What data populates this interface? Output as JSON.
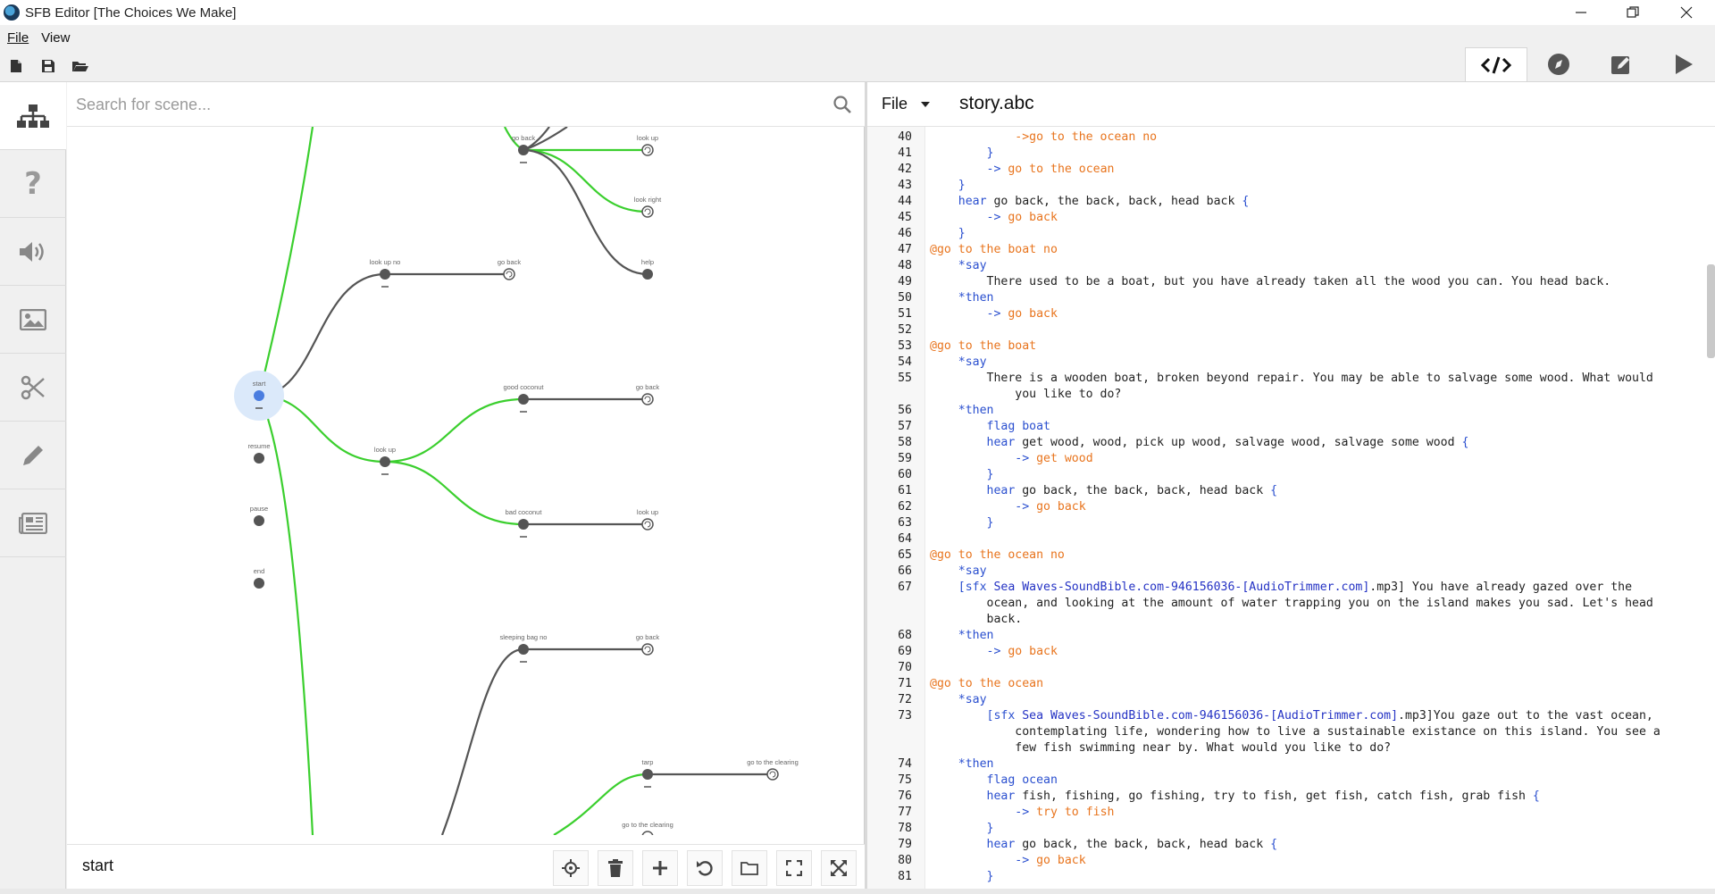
{
  "window": {
    "title": "SFB Editor [The Choices We Make]"
  },
  "menu": {
    "file": "File",
    "view": "View"
  },
  "toolbar": {
    "new_icon": "new-file-icon",
    "save_icon": "save-icon",
    "open_icon": "open-folder-icon"
  },
  "mode_tabs": [
    {
      "name": "code",
      "icon": "code-icon",
      "active": true
    },
    {
      "name": "navigate",
      "icon": "compass-icon",
      "active": false
    },
    {
      "name": "edit",
      "icon": "pencil-square-icon",
      "active": false
    },
    {
      "name": "play",
      "icon": "play-icon",
      "active": false
    }
  ],
  "sidebar": [
    {
      "icon": "hierarchy-icon",
      "active": true
    },
    {
      "icon": "question-icon",
      "active": false
    },
    {
      "icon": "speaker-icon",
      "active": false
    },
    {
      "icon": "image-icon",
      "active": false
    },
    {
      "icon": "scissors-icon",
      "active": false
    },
    {
      "icon": "pencil-icon",
      "active": false
    },
    {
      "icon": "newspaper-icon",
      "active": false
    }
  ],
  "graph": {
    "search_placeholder": "Search for scene...",
    "selected_scene": "start",
    "nodes": [
      {
        "id": "go-back-top",
        "label": "go back",
        "loop": false,
        "minus": true
      },
      {
        "id": "look-up-top",
        "label": "look up",
        "loop": true,
        "minus": false
      },
      {
        "id": "look-right",
        "label": "look right",
        "loop": true,
        "minus": false
      },
      {
        "id": "help",
        "label": "help",
        "loop": false,
        "minus": false
      },
      {
        "id": "look-up-no",
        "label": "look up no",
        "loop": false,
        "minus": true
      },
      {
        "id": "go-back-2",
        "label": "go back",
        "loop": true,
        "minus": false
      },
      {
        "id": "start",
        "label": "start",
        "loop": false,
        "minus": true,
        "selected": true
      },
      {
        "id": "resume",
        "label": "resume",
        "loop": false,
        "minus": false
      },
      {
        "id": "pause",
        "label": "pause",
        "loop": false,
        "minus": false
      },
      {
        "id": "end",
        "label": "end",
        "loop": false,
        "minus": false
      },
      {
        "id": "good-coconut",
        "label": "good coconut",
        "loop": false,
        "minus": true
      },
      {
        "id": "go-back-3",
        "label": "go back",
        "loop": true,
        "minus": false
      },
      {
        "id": "look-up",
        "label": "look up",
        "loop": false,
        "minus": true
      },
      {
        "id": "bad-coconut",
        "label": "bad coconut",
        "loop": false,
        "minus": true
      },
      {
        "id": "look-up-2",
        "label": "look up",
        "loop": true,
        "minus": false
      },
      {
        "id": "sleeping-bag-no",
        "label": "sleeping bag no",
        "loop": false,
        "minus": true
      },
      {
        "id": "go-back-4",
        "label": "go back",
        "loop": true,
        "minus": false
      },
      {
        "id": "tarp",
        "label": "tarp",
        "loop": false,
        "minus": true
      },
      {
        "id": "go-to-clearing-1",
        "label": "go to the clearing",
        "loop": true,
        "minus": false
      },
      {
        "id": "go-to-clearing-2",
        "label": "go to the clearing",
        "loop": true,
        "minus": false
      }
    ]
  },
  "graph_buttons": [
    {
      "name": "center",
      "icon": "crosshair-icon"
    },
    {
      "name": "delete",
      "icon": "trash-icon"
    },
    {
      "name": "add",
      "icon": "plus-icon"
    },
    {
      "name": "undo",
      "icon": "undo-icon"
    },
    {
      "name": "folder",
      "icon": "folder-icon"
    },
    {
      "name": "fit",
      "icon": "fit-screen-icon"
    },
    {
      "name": "expand",
      "icon": "expand-arrows-icon"
    }
  ],
  "editor": {
    "file_menu": "File",
    "filename": "story.abc",
    "lines": [
      {
        "n": "40",
        "segs": [
          [
            "",
            "            "
          ],
          [
            "k-orange",
            "->go to the ocean no"
          ]
        ]
      },
      {
        "n": "41",
        "segs": [
          [
            "k-blue",
            "        }"
          ]
        ]
      },
      {
        "n": "42",
        "segs": [
          [
            "",
            "        "
          ],
          [
            "k-blue",
            "->"
          ],
          [
            "k-orange",
            " go to the ocean"
          ]
        ]
      },
      {
        "n": "43",
        "segs": [
          [
            "k-blue",
            "    }"
          ]
        ]
      },
      {
        "n": "44",
        "segs": [
          [
            "",
            "    "
          ],
          [
            "k-blue",
            "hear"
          ],
          [
            "",
            " go back, the back, back, head back "
          ],
          [
            "k-blue",
            "{"
          ]
        ]
      },
      {
        "n": "45",
        "segs": [
          [
            "",
            "        "
          ],
          [
            "k-blue",
            "->"
          ],
          [
            "k-orange",
            " go back"
          ]
        ]
      },
      {
        "n": "46",
        "segs": [
          [
            "k-blue",
            "    }"
          ]
        ]
      },
      {
        "n": "47",
        "segs": [
          [
            "k-orange",
            "@go to the boat no"
          ]
        ]
      },
      {
        "n": "48",
        "segs": [
          [
            "",
            "    "
          ],
          [
            "k-blue",
            "*say"
          ]
        ]
      },
      {
        "n": "49",
        "segs": [
          [
            "",
            "        There used to be a boat, but you have already taken all the wood you can. You head back."
          ]
        ]
      },
      {
        "n": "50",
        "segs": [
          [
            "",
            "    "
          ],
          [
            "k-blue",
            "*then"
          ]
        ]
      },
      {
        "n": "51",
        "segs": [
          [
            "",
            "        "
          ],
          [
            "k-blue",
            "->"
          ],
          [
            "k-orange",
            " go back"
          ]
        ]
      },
      {
        "n": "52",
        "segs": [
          [
            "",
            ""
          ]
        ]
      },
      {
        "n": "53",
        "segs": [
          [
            "k-orange",
            "@go to the boat"
          ]
        ]
      },
      {
        "n": "54",
        "segs": [
          [
            "",
            "    "
          ],
          [
            "k-blue",
            "*say"
          ]
        ]
      },
      {
        "n": "55",
        "segs": [
          [
            "",
            "        There is a wooden boat, broken beyond repair. You may be able to salvage some wood. What would"
          ]
        ]
      },
      {
        "n": "",
        "segs": [
          [
            "",
            "            you like to do?"
          ]
        ]
      },
      {
        "n": "56",
        "segs": [
          [
            "",
            "    "
          ],
          [
            "k-blue",
            "*then"
          ]
        ]
      },
      {
        "n": "57",
        "segs": [
          [
            "",
            "        "
          ],
          [
            "k-blue",
            "flag boat"
          ]
        ]
      },
      {
        "n": "58",
        "segs": [
          [
            "",
            "        "
          ],
          [
            "k-blue",
            "hear"
          ],
          [
            "",
            " get wood, wood, pick up wood, salvage wood, salvage some wood "
          ],
          [
            "k-blue",
            "{"
          ]
        ]
      },
      {
        "n": "59",
        "segs": [
          [
            "",
            "            "
          ],
          [
            "k-blue",
            "->"
          ],
          [
            "k-orange",
            " get wood"
          ]
        ]
      },
      {
        "n": "60",
        "segs": [
          [
            "k-blue",
            "        }"
          ]
        ]
      },
      {
        "n": "61",
        "segs": [
          [
            "",
            "        "
          ],
          [
            "k-blue",
            "hear"
          ],
          [
            "",
            " go back, the back, back, head back "
          ],
          [
            "k-blue",
            "{"
          ]
        ]
      },
      {
        "n": "62",
        "segs": [
          [
            "",
            "            "
          ],
          [
            "k-blue",
            "->"
          ],
          [
            "k-orange",
            " go back"
          ]
        ]
      },
      {
        "n": "63",
        "segs": [
          [
            "k-blue",
            "        }"
          ]
        ]
      },
      {
        "n": "64",
        "segs": [
          [
            "",
            ""
          ]
        ]
      },
      {
        "n": "65",
        "segs": [
          [
            "k-orange",
            "@go to the ocean no"
          ]
        ]
      },
      {
        "n": "66",
        "segs": [
          [
            "",
            "    "
          ],
          [
            "k-blue",
            "*say"
          ]
        ]
      },
      {
        "n": "67",
        "segs": [
          [
            "",
            "    "
          ],
          [
            "k-blue",
            "[sfx "
          ],
          [
            "k-link",
            "Sea Waves-SoundBible.com-946156036-[AudioTrimmer.com]"
          ],
          [
            "",
            ".mp3] You have already gazed over the"
          ]
        ]
      },
      {
        "n": "",
        "segs": [
          [
            "",
            "        ocean, and looking at the amount of water trapping you on the island makes you sad. Let's head"
          ]
        ]
      },
      {
        "n": "",
        "segs": [
          [
            "",
            "        back."
          ]
        ]
      },
      {
        "n": "68",
        "segs": [
          [
            "",
            "    "
          ],
          [
            "k-blue",
            "*then"
          ]
        ]
      },
      {
        "n": "69",
        "segs": [
          [
            "",
            "        "
          ],
          [
            "k-blue",
            "->"
          ],
          [
            "k-orange",
            " go back"
          ]
        ]
      },
      {
        "n": "70",
        "segs": [
          [
            "",
            ""
          ]
        ]
      },
      {
        "n": "71",
        "segs": [
          [
            "k-orange",
            "@go to the ocean"
          ]
        ]
      },
      {
        "n": "72",
        "segs": [
          [
            "",
            "    "
          ],
          [
            "k-blue",
            "*say"
          ]
        ]
      },
      {
        "n": "73",
        "segs": [
          [
            "",
            "        "
          ],
          [
            "k-blue",
            "[sfx "
          ],
          [
            "k-link",
            "Sea Waves-SoundBible.com-946156036-[AudioTrimmer.com]"
          ],
          [
            "",
            ".mp3]You gaze out to the vast ocean,"
          ]
        ]
      },
      {
        "n": "",
        "segs": [
          [
            "",
            "            contemplating life, wondering how to live a sustainable existance on this island. You see a"
          ]
        ]
      },
      {
        "n": "",
        "segs": [
          [
            "",
            "            few fish swimming near by. What would you like to do?"
          ]
        ]
      },
      {
        "n": "74",
        "segs": [
          [
            "",
            "    "
          ],
          [
            "k-blue",
            "*then"
          ]
        ]
      },
      {
        "n": "75",
        "segs": [
          [
            "",
            "        "
          ],
          [
            "k-blue",
            "flag ocean"
          ]
        ]
      },
      {
        "n": "76",
        "segs": [
          [
            "",
            "        "
          ],
          [
            "k-blue",
            "hear"
          ],
          [
            "",
            " fish, fishing, go fishing, try to fish, get fish, catch fish, grab fish "
          ],
          [
            "k-blue",
            "{"
          ]
        ]
      },
      {
        "n": "77",
        "segs": [
          [
            "",
            "            "
          ],
          [
            "k-blue",
            "->"
          ],
          [
            "k-orange",
            " try to fish"
          ]
        ]
      },
      {
        "n": "78",
        "segs": [
          [
            "k-blue",
            "        }"
          ]
        ]
      },
      {
        "n": "79",
        "segs": [
          [
            "",
            "        "
          ],
          [
            "k-blue",
            "hear"
          ],
          [
            "",
            " go back, the back, back, head back "
          ],
          [
            "k-blue",
            "{"
          ]
        ]
      },
      {
        "n": "80",
        "segs": [
          [
            "",
            "            "
          ],
          [
            "k-blue",
            "->"
          ],
          [
            "k-orange",
            " go back"
          ]
        ]
      },
      {
        "n": "81",
        "segs": [
          [
            "k-blue",
            "        }"
          ]
        ]
      }
    ]
  }
}
